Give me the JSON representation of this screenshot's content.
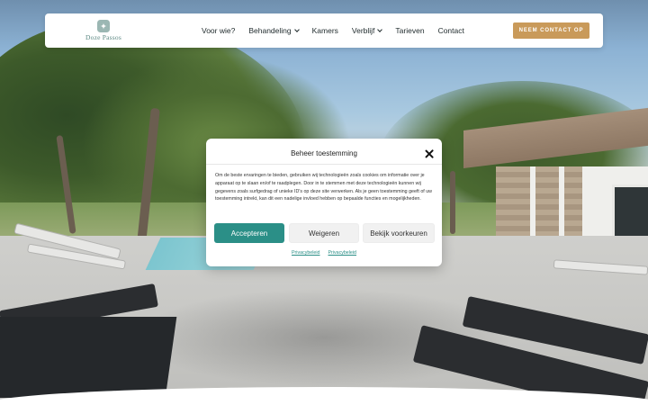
{
  "brand": {
    "name": "Doze Passos",
    "accent": "#c99a5a",
    "primary": "#2b8f87"
  },
  "nav": {
    "items": [
      {
        "label": "Voor wie?",
        "dropdown": false
      },
      {
        "label": "Behandeling",
        "dropdown": true
      },
      {
        "label": "Kamers",
        "dropdown": false
      },
      {
        "label": "Verblijf",
        "dropdown": true
      },
      {
        "label": "Tarieven",
        "dropdown": false
      },
      {
        "label": "Contact",
        "dropdown": false
      }
    ],
    "cta_label": "NEEM CONTACT OP"
  },
  "consent": {
    "title": "Beheer toestemming",
    "body": "Om de beste ervaringen te bieden, gebruiken wij technologieën zoals cookies om informatie over je apparaat op te slaan en/of te raadplegen. Door in te stemmen met deze technologieën kunnen wij gegevens zoals surfgedrag of unieke ID's op deze site verwerken. Als je geen toestemming geeft of uw toestemming intrekt, kan dit een nadelige invloed hebben op bepaalde functies en mogelijkheden.",
    "accept_label": "Accepteren",
    "deny_label": "Weigeren",
    "prefs_label": "Bekijk voorkeuren",
    "links": [
      "Privacybeleid",
      "Privacybeleid"
    ]
  },
  "icons": {
    "close": "close-icon",
    "chevron": "chevron-down-icon",
    "logo": "flower-logo-icon"
  }
}
